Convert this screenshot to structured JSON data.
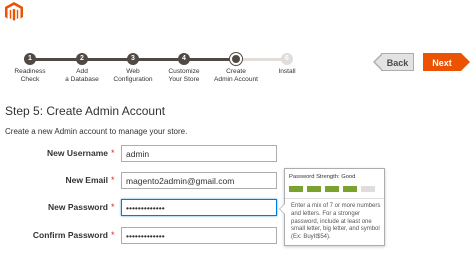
{
  "brand": {
    "logo_icon": "magento-logo-icon",
    "color": "#eb5202"
  },
  "steps": [
    {
      "number": "1",
      "label": "Readiness\nCheck",
      "state": "done"
    },
    {
      "number": "2",
      "label": "Add\na Database",
      "state": "done"
    },
    {
      "number": "3",
      "label": "Web\nConfiguration",
      "state": "done"
    },
    {
      "number": "4",
      "label": "Customize\nYour Store",
      "state": "done"
    },
    {
      "number": "",
      "label": "Create\nAdmin Account",
      "state": "active"
    },
    {
      "number": "6",
      "label": "Install",
      "state": "todo"
    }
  ],
  "nav": {
    "back_label": "Back",
    "next_label": "Next"
  },
  "page": {
    "title": "Step 5: Create Admin Account",
    "subtitle": "Create a new Admin account to manage your store."
  },
  "form": {
    "username": {
      "label": "New Username",
      "value": "admin",
      "required_mark": "*"
    },
    "email": {
      "label": "New Email",
      "value": "magento2admin@gmail.com",
      "required_mark": "*"
    },
    "password": {
      "label": "New Password",
      "value": "•••••••••••••",
      "required_mark": "*"
    },
    "confirm": {
      "label": "Confirm Password",
      "value": "•••••••••••••",
      "required_mark": "*"
    }
  },
  "strength_tip": {
    "heading": "Password Strength: Good",
    "segments_filled": 4,
    "segments_total": 5,
    "filled_color": "#79a22e",
    "empty_color": "#e0ddda",
    "text": "Enter a mix of 7 or more numbers and letters. For a stronger password, include at least one small letter, big letter, and symbol (Ex: BuyIt$54)."
  }
}
